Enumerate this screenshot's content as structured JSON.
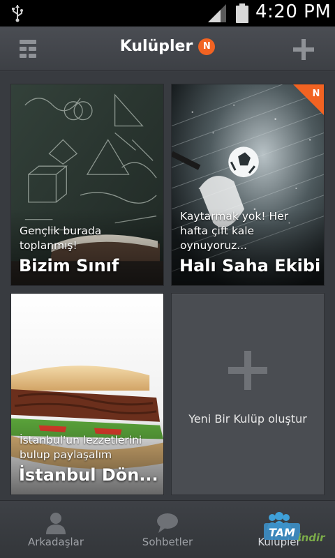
{
  "status_bar": {
    "time": "4:20 PM"
  },
  "header": {
    "title": "Kulüpler",
    "badge": "N"
  },
  "clubs": [
    {
      "desc": "Gençlik burada toplanmış!",
      "name": "Bizim Sınıf"
    },
    {
      "desc": "Kaytarmak yok! Her hafta çift kale oynuyoruz...",
      "name": "Halı Saha Ekibi",
      "badge": "N"
    },
    {
      "desc": "İstanbul'un lezzetlerini bulup paylaşalım",
      "name": "İstanbul Dön..."
    }
  ],
  "create_card": {
    "label": "Yeni Bir Kulüp oluştur"
  },
  "bottom_nav": [
    {
      "label": "Arkadaşlar",
      "icon": "person-icon"
    },
    {
      "label": "Sohbetler",
      "icon": "chat-bubble-icon"
    },
    {
      "label": "Kulüpler",
      "icon": "group-icon",
      "active": true
    }
  ],
  "watermark": {
    "line1": "TAM",
    "line2": "indir"
  },
  "colors": {
    "accent": "#f26322",
    "background": "#383b40",
    "header": "#45484d"
  }
}
